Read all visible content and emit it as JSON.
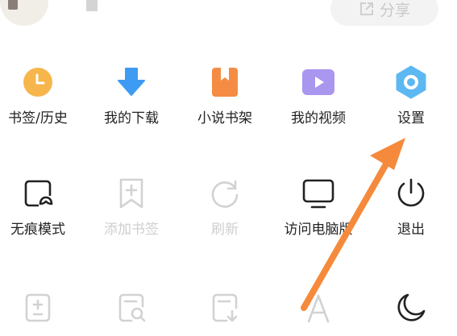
{
  "header": {
    "share_label": "分享"
  },
  "menu": {
    "row1": [
      {
        "label": "书签/历史",
        "icon": "clock-icon",
        "color": "#F6B64C"
      },
      {
        "label": "我的下载",
        "icon": "download-arrow-icon",
        "color": "#3E9BF3"
      },
      {
        "label": "小说书架",
        "icon": "bookmark-book-icon",
        "color": "#F48D43"
      },
      {
        "label": "我的视频",
        "icon": "video-play-icon",
        "color": "#A996EF"
      },
      {
        "label": "设置",
        "icon": "settings-hexagon-icon",
        "color": "#5DB8F2"
      }
    ],
    "row2": [
      {
        "label": "无痕模式",
        "icon": "incognito-icon",
        "enabled": true
      },
      {
        "label": "添加书签",
        "icon": "add-bookmark-icon",
        "enabled": false
      },
      {
        "label": "刷新",
        "icon": "refresh-icon",
        "enabled": false
      },
      {
        "label": "访问电脑版",
        "icon": "desktop-monitor-icon",
        "enabled": true
      },
      {
        "label": "退出",
        "icon": "power-icon",
        "enabled": true
      }
    ],
    "row3": [
      {
        "icon": "zoom-icon",
        "enabled": false
      },
      {
        "icon": "find-in-page-icon",
        "enabled": false
      },
      {
        "icon": "save-page-icon",
        "enabled": false
      },
      {
        "icon": "font-size-icon",
        "enabled": false
      },
      {
        "icon": "night-mode-moon-icon",
        "enabled": true
      }
    ]
  },
  "annotation": {
    "arrow_color": "#F58A3C"
  }
}
